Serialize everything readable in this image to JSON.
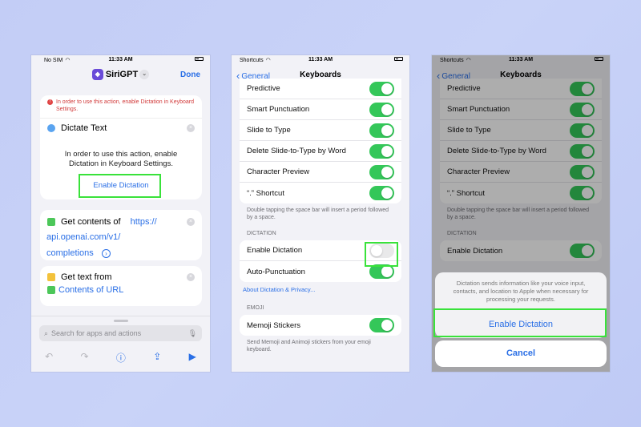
{
  "colors": {
    "accent": "#2a6fe6",
    "toggle_on": "#34c759",
    "highlight": "#39e23a",
    "warning": "#d23b3b"
  },
  "phone1": {
    "status": {
      "carrier": "No SIM",
      "time": "11:33 AM"
    },
    "nav": {
      "title": "SiriGPT",
      "done": "Done"
    },
    "warning": "In order to use this action, enable Dictation in Keyboard Settings.",
    "dictate": {
      "label": "Dictate Text",
      "info": "In order to use this action, enable Dictation in Keyboard Settings.",
      "button": "Enable Dictation"
    },
    "get_contents": {
      "label": "Get contents of",
      "url1": "https://",
      "url2": "api.openai.com/v1/",
      "url3": "completions"
    },
    "get_text": {
      "label": "Get text from",
      "source": "Contents of URL"
    },
    "search": {
      "placeholder": "Search for apps and actions"
    }
  },
  "phone2": {
    "status": {
      "back_app": "Shortcuts",
      "time": "11:33 AM"
    },
    "nav": {
      "back": "General",
      "title": "Keyboards"
    },
    "rows": [
      {
        "label": "Predictive"
      },
      {
        "label": "Smart Punctuation"
      },
      {
        "label": "Slide to Type"
      },
      {
        "label": "Delete Slide-to-Type by Word"
      },
      {
        "label": "Character Preview"
      },
      {
        "label": "“.” Shortcut"
      }
    ],
    "shortcut_footer": "Double tapping the space bar will insert a period followed by a space.",
    "dictation_header": "DICTATION",
    "enable_dictation": "Enable Dictation",
    "auto_punctuation": "Auto-Punctuation",
    "about_link": "About Dictation & Privacy...",
    "emoji_header": "EMOJI",
    "memoji": "Memoji Stickers",
    "memoji_footer": "Send Memoji and Animoji stickers from your emoji keyboard."
  },
  "phone3": {
    "status": {
      "back_app": "Shortcuts",
      "time": "11:33 AM"
    },
    "nav": {
      "back": "General",
      "title": "Keyboards"
    },
    "sheet_message": "Dictation sends information like your voice input, contacts, and location to Apple when necessary for processing your requests.",
    "enable_button": "Enable Dictation",
    "cancel_button": "Cancel"
  }
}
